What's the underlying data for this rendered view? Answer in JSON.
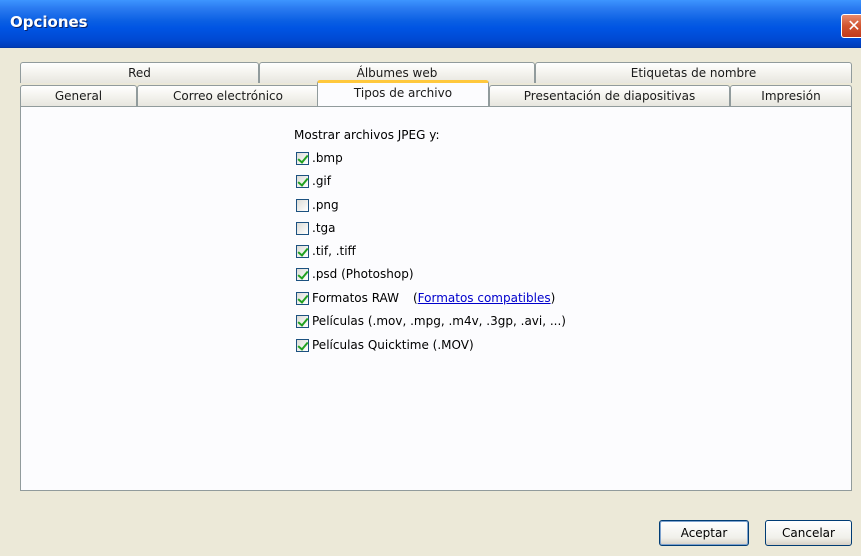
{
  "window": {
    "title": "Opciones",
    "close_glyph": "✕"
  },
  "tabs": {
    "row1": [
      "Red",
      "Álbumes web",
      "Etiquetas de nombre"
    ],
    "row2": [
      "General",
      "Correo electrónico",
      "Tipos de archivo",
      "Presentación de diapositivas",
      "Impresión"
    ],
    "active": "Tipos de archivo"
  },
  "panel": {
    "heading": "Mostrar archivos JPEG y:",
    "options": [
      {
        "label": ".bmp",
        "checked": true
      },
      {
        "label": ".gif",
        "checked": true
      },
      {
        "label": ".png",
        "checked": false
      },
      {
        "label": ".tga",
        "checked": false
      },
      {
        "label": ".tif, .tiff",
        "checked": true
      },
      {
        "label": ".psd (Photoshop)",
        "checked": true
      },
      {
        "label": "Formatos RAW",
        "checked": true,
        "link_open": "(",
        "link": "Formatos compatibles",
        "link_close": ")"
      },
      {
        "label": "Películas (.mov, .mpg, .m4v, .3gp, .avi, ...)",
        "checked": true
      },
      {
        "label": "Películas Quicktime (.MOV)",
        "checked": true
      }
    ]
  },
  "buttons": {
    "ok": "Aceptar",
    "cancel": "Cancelar"
  }
}
